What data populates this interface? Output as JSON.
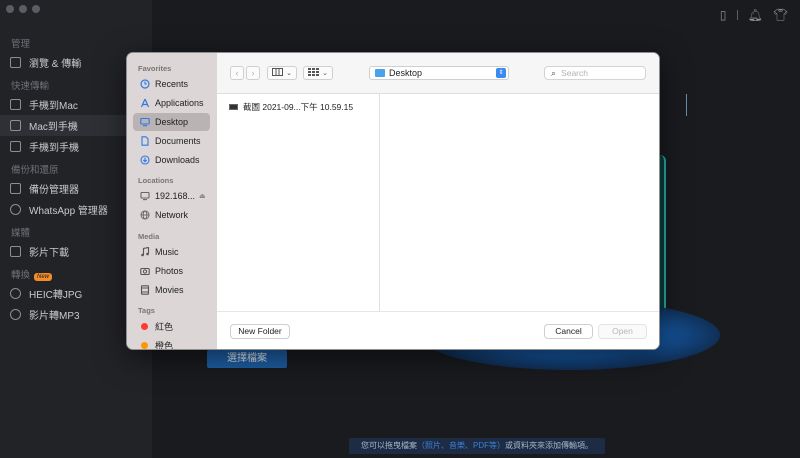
{
  "app": {
    "sidebar": {
      "sections": [
        {
          "title": "管理",
          "items": [
            {
              "label": "瀏覽 & 傳輸",
              "icon": "grid-icon"
            }
          ]
        },
        {
          "title": "快速傳輸",
          "items": [
            {
              "label": "手機到Mac",
              "icon": "phone-to-mac-icon"
            },
            {
              "label": "Mac到手機",
              "icon": "mac-to-phone-icon",
              "active": true
            },
            {
              "label": "手機到手機",
              "icon": "phone-to-phone-icon"
            }
          ]
        },
        {
          "title": "備份和還原",
          "items": [
            {
              "label": "備份管理器",
              "icon": "backup-icon"
            },
            {
              "label": "WhatsApp 管理器",
              "icon": "whatsapp-icon"
            }
          ]
        },
        {
          "title": "媒體",
          "items": [
            {
              "label": "影片下載",
              "icon": "video-download-icon"
            }
          ]
        },
        {
          "title": "轉換",
          "badge": "New",
          "items": [
            {
              "label": "HEIC轉JPG",
              "icon": "heic-convert-icon"
            },
            {
              "label": "影片轉MP3",
              "icon": "mp3-convert-icon"
            }
          ]
        }
      ]
    },
    "top_icons": [
      "device-icon",
      "bell-icon",
      "shirt-icon"
    ],
    "choose_file_button": "選擇檔案",
    "bottom_hint": {
      "prefix": "您可以拖曳檔案",
      "highlight": "（照片、音樂、PDF等）",
      "suffix": "或資料夾來添加傳輸項。"
    },
    "accent_color": "#1e5fa5"
  },
  "dialog": {
    "sidebar": {
      "favorites_title": "Favorites",
      "favorites": [
        {
          "label": "Recents",
          "icon": "clock-icon"
        },
        {
          "label": "Applications",
          "icon": "applications-icon"
        },
        {
          "label": "Desktop",
          "icon": "desktop-icon",
          "selected": true
        },
        {
          "label": "Documents",
          "icon": "document-icon"
        },
        {
          "label": "Downloads",
          "icon": "download-icon"
        }
      ],
      "locations_title": "Locations",
      "locations": [
        {
          "label": "192.168...",
          "icon": "computer-icon",
          "eject": "⏏"
        },
        {
          "label": "Network",
          "icon": "network-icon"
        }
      ],
      "media_title": "Media",
      "media": [
        {
          "label": "Music",
          "icon": "music-icon"
        },
        {
          "label": "Photos",
          "icon": "camera-icon"
        },
        {
          "label": "Movies",
          "icon": "film-icon"
        }
      ],
      "tags_title": "Tags",
      "tags": [
        {
          "label": "紅色",
          "color": "#ff3b30"
        },
        {
          "label": "橙色",
          "color": "#ff9500"
        }
      ]
    },
    "toolbar": {
      "back": "‹",
      "forward": "›",
      "view_columns": "column-view-icon",
      "view_grid": "grid-view-icon",
      "location": "Desktop",
      "search_placeholder": "Search"
    },
    "files": [
      {
        "name": "截圖 2021-09...下午 10.59.15",
        "icon": "screenshot-file-icon"
      }
    ],
    "footer": {
      "new_folder": "New Folder",
      "cancel": "Cancel",
      "open": "Open"
    }
  }
}
